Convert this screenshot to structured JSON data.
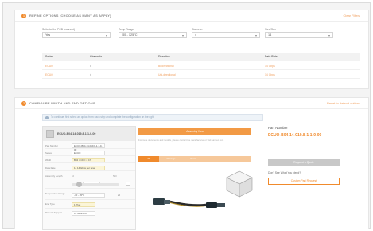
{
  "section1": {
    "step": "1",
    "title": "REFINE OPTIONS (CHOOSE AS MANY AS APPLY)",
    "link": "Clear Filters",
    "filters": [
      {
        "label": "Suits for the PCB (connect)",
        "value": "Yes"
      },
      {
        "label": "Temp Range",
        "value": "-55 - 125°C"
      },
      {
        "label": "Diameter",
        "value": "4"
      },
      {
        "label": "Size/Gen",
        "value": "14"
      }
    ],
    "table": {
      "headers": [
        "Series",
        "Channels",
        "Direction",
        "Data Rate"
      ],
      "rows": [
        [
          "ECUO",
          "4",
          "Bi-directional",
          "14 Gbps"
        ],
        [
          "ECUO",
          "4",
          "Uni-directional",
          "14 Gbps"
        ]
      ]
    }
  },
  "section2": {
    "step": "2",
    "title": "CONFIGURE WIDTH AND END OPTIONS",
    "link": "Reset to default options",
    "hint": "To continue, first select an option from each step and complete the configuration on the right",
    "config": {
      "product": "ECUO-B04-14-019.8-1-1-0-00",
      "rows": [
        {
          "label": "Part Number",
          "value": "ECUO-B04-14-019.8-1-1-0-00"
        },
        {
          "label": "Series",
          "value": "ECUO"
        },
        {
          "label": "Width",
          "value": "B04 4 Ch = 4 Ch"
        },
        {
          "label": "Data Rate",
          "value": "14 14 Gbps per lane"
        },
        {
          "label": "Assembly Length",
          "value": "019.8"
        },
        {
          "label": "Qty",
          "value": "1"
        },
        {
          "label": "Temperature Range",
          "value": "-40 - 85°C"
        },
        {
          "label": "End Type",
          "value": "1 Plug"
        },
        {
          "label": "Protocol Support",
          "value": "0 - Multi-Pro"
        }
      ],
      "slider_min": "10",
      "slider_max": "500",
      "qty_side": "20"
    },
    "viewer_title": "Assembly View",
    "viewer_note": "For more documents and models, please contact the manufacturer or visit samtec.com",
    "tabs": [
      "3D",
      "Drawings",
      "Specs"
    ],
    "part_number_label": "Part Number",
    "part_number": "ECUO-B04-14-019.8-1-1-0-00",
    "request_button": "Request a Quote",
    "question": "Don't See What You Need?",
    "custom_button": "Custom Part Request"
  },
  "colors": {
    "accent": "#f08a2c",
    "accent_light": "#f29a45"
  }
}
